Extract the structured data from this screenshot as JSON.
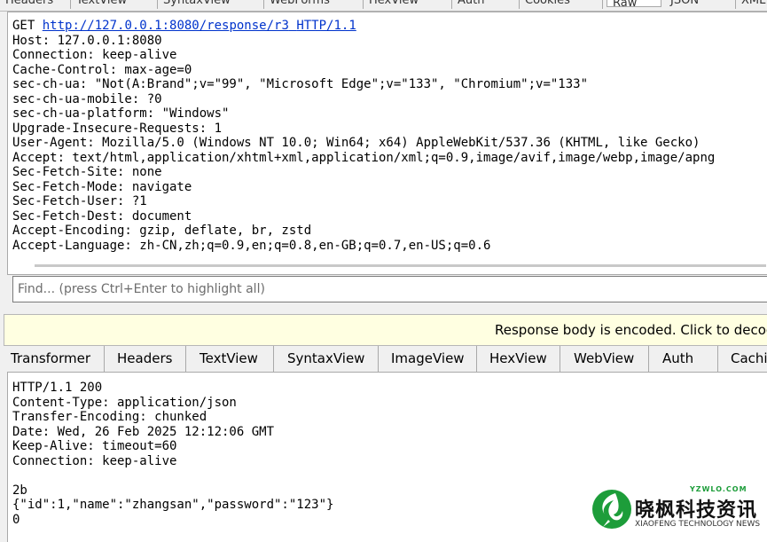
{
  "top_tabs": [
    "Headers",
    "TextView",
    "SyntaxView",
    "WebForms",
    "HexView",
    "Auth",
    "Cookies",
    "Raw",
    "JSON",
    "XML"
  ],
  "request": {
    "method": "GET",
    "url": "http://127.0.0.1:8080/response/r3",
    "protocol": "HTTP/1.1",
    "header_lines": [
      "Host: 127.0.0.1:8080",
      "Connection: keep-alive",
      "Cache-Control: max-age=0",
      "sec-ch-ua: \"Not(A:Brand\";v=\"99\", \"Microsoft Edge\";v=\"133\", \"Chromium\";v=\"133\"",
      "sec-ch-ua-mobile: ?0",
      "sec-ch-ua-platform: \"Windows\"",
      "Upgrade-Insecure-Requests: 1",
      "User-Agent: Mozilla/5.0 (Windows NT 10.0; Win64; x64) AppleWebKit/537.36 (KHTML, like Gecko)",
      "Accept: text/html,application/xhtml+xml,application/xml;q=0.9,image/avif,image/webp,image/apng",
      "Sec-Fetch-Site: none",
      "Sec-Fetch-Mode: navigate",
      "Sec-Fetch-User: ?1",
      "Sec-Fetch-Dest: document",
      "Accept-Encoding: gzip, deflate, br, zstd",
      "Accept-Language: zh-CN,zh;q=0.9,en;q=0.8,en-GB;q=0.7,en-US;q=0.6"
    ]
  },
  "find": {
    "placeholder": "Find... (press Ctrl+Enter to highlight all)",
    "value": ""
  },
  "notice": {
    "text": "Response body is encoded. Click to decode."
  },
  "response_tabs": [
    "Transformer",
    "Headers",
    "TextView",
    "SyntaxView",
    "ImageView",
    "HexView",
    "WebView",
    "Auth",
    "Caching"
  ],
  "response": {
    "lines": [
      "HTTP/1.1 200",
      "Content-Type: application/json",
      "Transfer-Encoding: chunked",
      "Date: Wed, 26 Feb 2025 12:12:06 GMT",
      "Keep-Alive: timeout=60",
      "Connection: keep-alive",
      "",
      "2b",
      "{\"id\":1,\"name\":\"zhangsan\",\"password\":\"123\"}",
      "0"
    ]
  },
  "watermark": {
    "url": "YZWLO.COM",
    "name_cn": "晓枫科技资讯",
    "name_en": "XIAOFENG TECHNOLOGY NEWS",
    "brand_color": "#1d9d3a"
  }
}
